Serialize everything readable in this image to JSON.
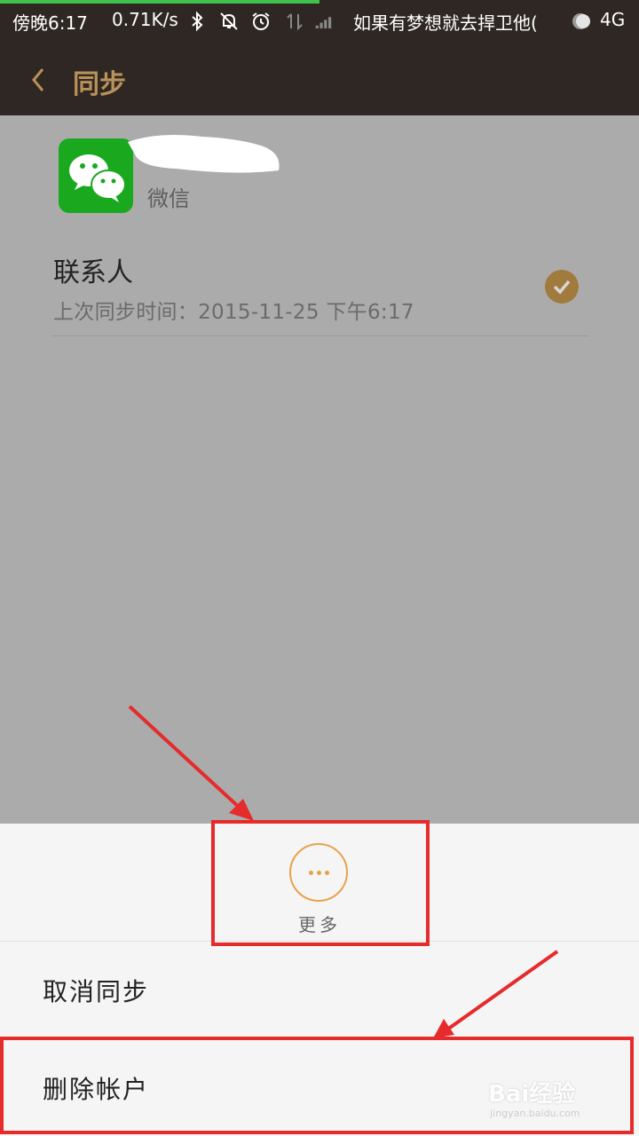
{
  "status_bar": {
    "time": "傍晚6:17",
    "net_speed": "0.71K/s",
    "carrier": "如果有梦想就去捍卫他(",
    "network": "4G",
    "icons": [
      "bluetooth-icon",
      "mute-icon",
      "alarm-icon",
      "data-arrows-icon",
      "signal-icon",
      "moon-icon"
    ]
  },
  "header": {
    "title": "同步",
    "back_icon": "chevron-left-icon",
    "accent_color": "#b9915a"
  },
  "account": {
    "app_icon": "wechat-icon",
    "type_label": "微信"
  },
  "sync_item": {
    "label": "联系人",
    "last_sync": "上次同步时间：2015-11-25 下午6:17",
    "checked": true
  },
  "sheet": {
    "more_label": "更多",
    "menu": [
      "取消同步",
      "删除帐户"
    ]
  },
  "annotations": {
    "highlight_color": "#e52b2b"
  },
  "watermark": {
    "text": "Bai经验",
    "sub": "jingyan.baidu.com"
  }
}
